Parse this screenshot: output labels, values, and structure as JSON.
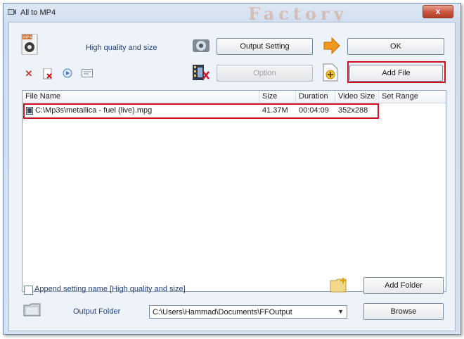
{
  "window": {
    "title": "All to MP4",
    "watermark": "Factory",
    "close_label": "x"
  },
  "toolbar": {
    "profile_label": "High quality and size",
    "output_setting_label": "Output Setting",
    "ok_label": "OK",
    "option_label": "Option",
    "add_file_label": "Add File"
  },
  "table": {
    "columns": [
      "File Name",
      "Size",
      "Duration",
      "Video Size",
      "Set Range"
    ],
    "rows": [
      {
        "file_name": "C:\\Mp3s\\metallica - fuel (live).mpg",
        "size": "41.37M",
        "duration": "00:04:09",
        "video_size": "352x288",
        "set_range": ""
      }
    ]
  },
  "bottom": {
    "append_label": "Append setting name [High quality and size]",
    "append_checked": false,
    "add_folder_label": "Add Folder",
    "output_folder_label": "Output Folder",
    "output_folder_value": "C:\\Users\\Hammad\\Documents\\FFOutput",
    "browse_label": "Browse"
  },
  "colors": {
    "highlight": "#d0101e",
    "label_blue": "#1f3f7a",
    "arrow_orange": "#f39a1e"
  }
}
